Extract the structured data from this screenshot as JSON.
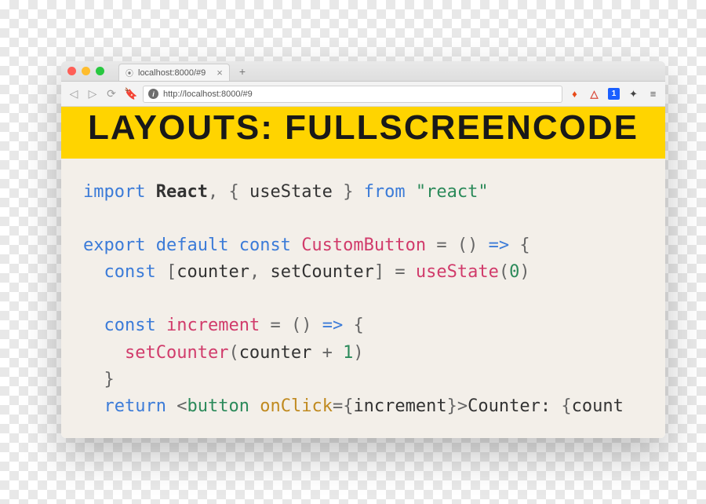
{
  "window": {
    "tab": {
      "title": "localhost:8000/#9",
      "close": "×"
    },
    "newtab": "+"
  },
  "addrbar": {
    "url": "http://localhost:8000/#9"
  },
  "banner": {
    "heading": "LAYOUTS: FULLSCREENCODE"
  },
  "code": {
    "l1": {
      "import": "import",
      "react": "React",
      "c1": ",",
      "ob": "{",
      "us": "useState",
      "cb": "}",
      "from": "from",
      "str": "\"react\""
    },
    "l3": {
      "export": "export",
      "default": "default",
      "const": "const",
      "name": "CustomButton",
      "eq": "=",
      "par": "()",
      "arr": "=>",
      "ob": "{"
    },
    "l4": {
      "const": "const",
      "ob": "[",
      "a": "counter",
      "c": ",",
      "b": "setCounter",
      "cb": "]",
      "eq": "=",
      "fn": "useState",
      "po": "(",
      "n": "0",
      "pc": ")"
    },
    "l6": {
      "const": "const",
      "name": "increment",
      "eq": "=",
      "par": "()",
      "arr": "=>",
      "ob": "{"
    },
    "l7": {
      "fn": "setCounter",
      "po": "(",
      "a": "counter",
      "plus": "+",
      "n": "1",
      "pc": ")"
    },
    "l8": {
      "cb": "}"
    },
    "l9": {
      "return": "return",
      "lt": "<",
      "tag": "button",
      "attr": "onClick",
      "eq": "=",
      "ob": "{",
      "v": "increment",
      "cb": "}",
      "gt": ">",
      "txt": "Counter: ",
      "ob2": "{",
      "v2": "count"
    }
  }
}
